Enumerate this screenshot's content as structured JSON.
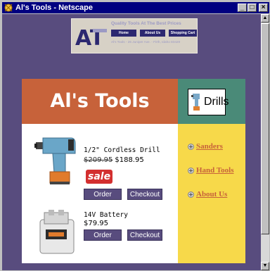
{
  "window": {
    "title": "Al's Tools - Netscape",
    "icon": "netscape-icon",
    "buttons": {
      "minimize": "_",
      "maximize": "□",
      "close": "×"
    }
  },
  "banner": {
    "tagline": "Quality Tools At The Best Prices",
    "nav": [
      "Home",
      "About Us",
      "Shopping Cart"
    ],
    "address": "Al's Tools - 26 Juniper Ave. - Firth, Idaho 83420",
    "logo_text": "AT"
  },
  "header": {
    "site_title": "Al's Tools",
    "category_label": "Drills"
  },
  "products": [
    {
      "name": "1/2\" Cordless Drill",
      "old_price": "$209.95",
      "price": "$188.95",
      "badge": "sale",
      "order_label": "Order",
      "checkout_label": "Checkout"
    },
    {
      "name": "14V Battery",
      "price": "$79.95",
      "order_label": "Order",
      "checkout_label": "Checkout"
    }
  ],
  "sidebar": {
    "links": [
      "Sanders",
      "Hand Tools",
      "About Us"
    ]
  },
  "colors": {
    "page_bg": "#584c7e",
    "header_brown": "#c7623a",
    "header_teal": "#4a8a78",
    "sidebar_yellow": "#f7d94a",
    "button": "#584c7e",
    "sale_red": "#d32f2f"
  }
}
